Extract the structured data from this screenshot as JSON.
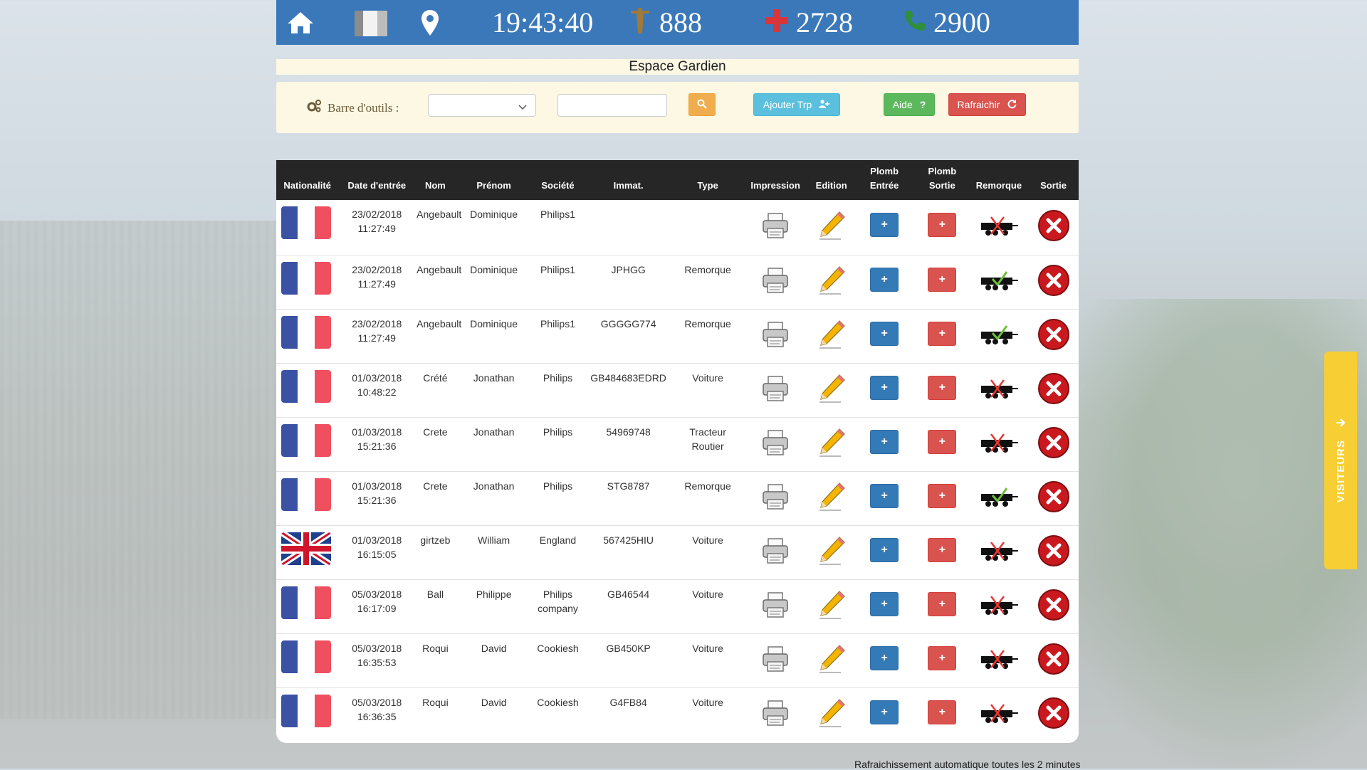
{
  "header": {
    "clock": "19:43:40",
    "stat_tower": "888",
    "stat_medical": "2728",
    "stat_phone": "2900"
  },
  "page_title": "Espace Gardien",
  "toolbar": {
    "label": "Barre d'outils :",
    "select_value": "",
    "search_value": "",
    "add_label": "Ajouter Trp",
    "help_label": "Aide",
    "refresh_label": "Rafraichir"
  },
  "table": {
    "columns": [
      "Nationalité",
      "Date d'entrée",
      "Nom",
      "Prénom",
      "Société",
      "Immat.",
      "Type",
      "Impression",
      "Edition",
      "Plomb Entrée",
      "Plomb Sortie",
      "Remorque",
      "Sortie"
    ],
    "rows": [
      {
        "flag": "fr",
        "date": "23/02/2018",
        "time": "11:27:49",
        "nom": "Angebault",
        "prenom": "Dominique",
        "societe": "Philips1",
        "immat": "",
        "type": "",
        "remorque": "none"
      },
      {
        "flag": "fr",
        "date": "23/02/2018",
        "time": "11:27:49",
        "nom": "Angebault",
        "prenom": "Dominique",
        "societe": "Philips1",
        "immat": "JPHGG",
        "type": "Remorque",
        "remorque": "ok"
      },
      {
        "flag": "fr",
        "date": "23/02/2018",
        "time": "11:27:49",
        "nom": "Angebault",
        "prenom": "Dominique",
        "societe": "Philips1",
        "immat": "GGGGG774",
        "type": "Remorque",
        "remorque": "ok"
      },
      {
        "flag": "fr",
        "date": "01/03/2018",
        "time": "10:48:22",
        "nom": "Crété",
        "prenom": "Jonathan",
        "societe": "Philips",
        "immat": "GB484683EDRD",
        "type": "Voiture",
        "remorque": "none"
      },
      {
        "flag": "fr",
        "date": "01/03/2018",
        "time": "15:21:36",
        "nom": "Crete",
        "prenom": "Jonathan",
        "societe": "Philips",
        "immat": "54969748",
        "type": "Tracteur Routier",
        "remorque": "none"
      },
      {
        "flag": "fr",
        "date": "01/03/2018",
        "time": "15:21:36",
        "nom": "Crete",
        "prenom": "Jonathan",
        "societe": "Philips",
        "immat": "STG8787",
        "type": "Remorque",
        "remorque": "ok"
      },
      {
        "flag": "uk",
        "date": "01/03/2018",
        "time": "16:15:05",
        "nom": "girtzeb",
        "prenom": "William",
        "societe": "England",
        "immat": "567425HIU",
        "type": "Voiture",
        "remorque": "none"
      },
      {
        "flag": "fr",
        "date": "05/03/2018",
        "time": "16:17:09",
        "nom": "Ball",
        "prenom": "Philippe",
        "societe": "Philips company",
        "immat": "GB46544",
        "type": "Voiture",
        "remorque": "none"
      },
      {
        "flag": "fr",
        "date": "05/03/2018",
        "time": "16:35:53",
        "nom": "Roqui",
        "prenom": "David",
        "societe": "Cookiesh",
        "immat": "GB450KP",
        "type": "Voiture",
        "remorque": "none"
      },
      {
        "flag": "fr",
        "date": "05/03/2018",
        "time": "16:36:35",
        "nom": "Roqui",
        "prenom": "David",
        "societe": "Cookiesh",
        "immat": "G4FB84",
        "type": "Voiture",
        "remorque": "none"
      }
    ]
  },
  "footer_note": "Rafraichissement automatique toutes les 2 minutes",
  "side_tab": "VISITEURS",
  "colors": {
    "header_blue": "#3a78b9",
    "title_bg": "#fcf8e3",
    "btn_orange": "#f0ad4e",
    "btn_info": "#5bc0de",
    "btn_green": "#5cb85c",
    "btn_red": "#d9534f",
    "plomb_blue": "#337ab7",
    "side_yellow": "#f7cf34"
  },
  "icons": {
    "home": "home-icon",
    "building": "building-icon",
    "location": "map-marker-icon",
    "tower": "tower-icon",
    "medical": "medical-cross-icon",
    "phone": "phone-icon",
    "gears": "gears-icon",
    "search": "search-icon",
    "add_user": "user-plus-icon",
    "help": "question-icon",
    "refresh": "refresh-icon",
    "printer": "printer-icon",
    "pencil": "pencil-icon",
    "trailer": "trailer-icon",
    "close": "close-icon",
    "arrow": "arrow-right-icon"
  }
}
